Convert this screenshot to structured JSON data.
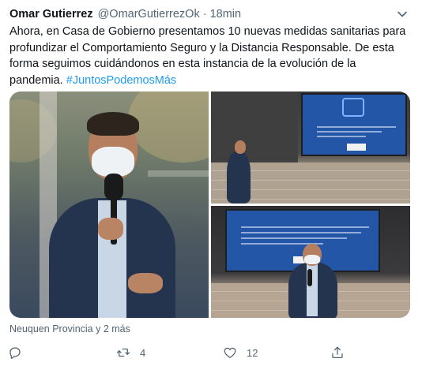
{
  "tweet": {
    "author_name": "Omar Gutierrez",
    "author_handle": "@OmarGutierrezOk",
    "separator": "·",
    "timestamp": "18min",
    "text_lines": [
      "Ahora, en Casa de Gobierno presentamos 10 nuevas medidas sanitarias para",
      "profundizar el Comportamiento Seguro y la Distancia Responsable. De esta",
      "forma seguimos cuidándonos en esta instancia de la evolución de la",
      "pandemia. "
    ],
    "hashtag": "#JuntosPodemosMás",
    "location": "Neuquen Provincia y 2 más",
    "reply_count": "",
    "retweet_count": "4",
    "like_count": "12"
  },
  "icons": {
    "more": "chevron-down-icon",
    "reply": "reply-icon",
    "retweet": "retweet-icon",
    "like": "heart-icon",
    "share": "share-icon"
  },
  "colors": {
    "text": "#0f1419",
    "secondary": "#536471",
    "link": "#1d9bf0"
  }
}
